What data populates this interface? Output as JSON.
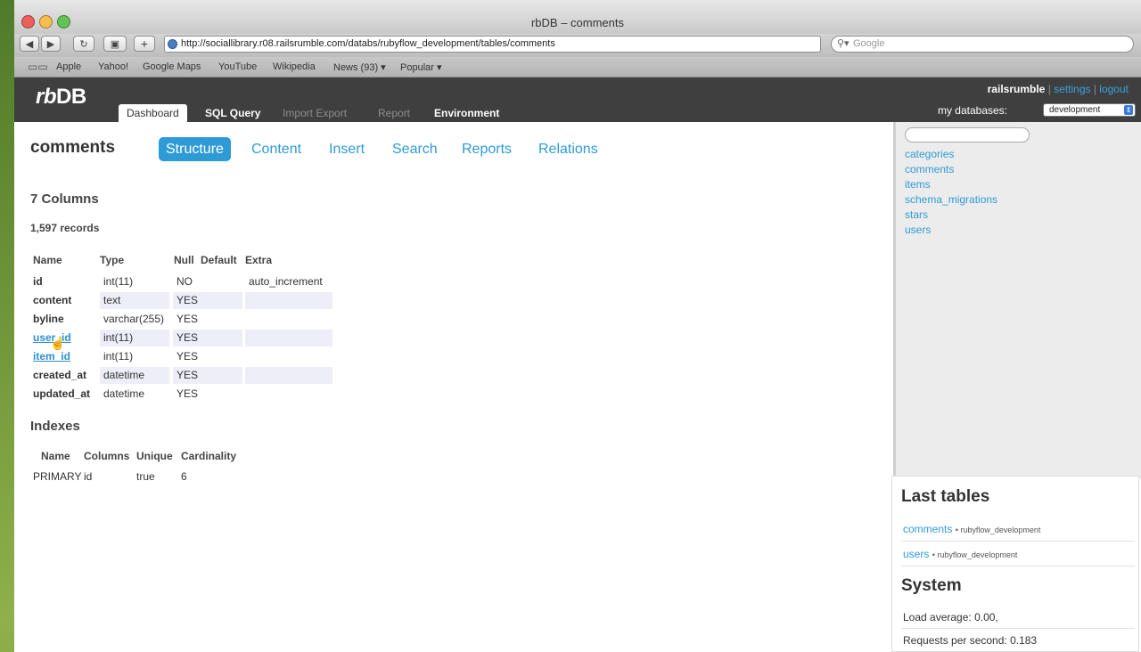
{
  "browser": {
    "title": "rbDB – comments",
    "url": "http://sociallibrary.r08.railsrumble.com/databs/rubyflow_development/tables/comments",
    "search_placeholder": "Google",
    "bookmarks": [
      "Apple",
      "Yahoo!",
      "Google Maps",
      "YouTube",
      "Wikipedia",
      "News (93) ▾",
      "Popular ▾"
    ]
  },
  "app": {
    "logo_prefix": "rb",
    "logo_suffix": "DB",
    "tabs": [
      "Dashboard",
      "SQL Query",
      "Import Export",
      "Report",
      "Environment"
    ],
    "user": "railsrumble",
    "settings": "settings",
    "logout": "logout",
    "my_databases_label": "my databases:",
    "selected_database": "development"
  },
  "table": {
    "name": "comments",
    "subtabs": [
      "Structure",
      "Content",
      "Insert",
      "Search",
      "Reports",
      "Relations"
    ],
    "columns_heading": "7 Columns",
    "records": "1,597 records",
    "column_headers": [
      "Name",
      "Type",
      "Null",
      "Default",
      "Extra"
    ],
    "columns": [
      {
        "name": "id",
        "type": "int(11)",
        "null": "NO",
        "default": "",
        "extra": "auto_increment"
      },
      {
        "name": "content",
        "type": "text",
        "null": "YES",
        "default": "",
        "extra": ""
      },
      {
        "name": "byline",
        "type": "varchar(255)",
        "null": "YES",
        "default": "",
        "extra": ""
      },
      {
        "name": "user_id",
        "type": "int(11)",
        "null": "YES",
        "default": "",
        "extra": ""
      },
      {
        "name": "item_id",
        "type": "int(11)",
        "null": "YES",
        "default": "",
        "extra": ""
      },
      {
        "name": "created_at",
        "type": "datetime",
        "null": "YES",
        "default": "",
        "extra": ""
      },
      {
        "name": "updated_at",
        "type": "datetime",
        "null": "YES",
        "default": "",
        "extra": ""
      }
    ],
    "indexes_heading": "Indexes",
    "index_headers": [
      "Name",
      "Columns",
      "Unique",
      "Cardinality"
    ],
    "indexes": [
      {
        "name": "PRIMARY",
        "columns": "id",
        "unique": "true",
        "cardinality": "6"
      }
    ]
  },
  "sidebar": {
    "tables": [
      "categories",
      "comments",
      "items",
      "schema_migrations",
      "stars",
      "users"
    ]
  },
  "last_tables": {
    "heading": "Last tables",
    "items": [
      {
        "table": "comments",
        "schema": "• rubyflow_development"
      },
      {
        "table": "users",
        "schema": "• rubyflow_development"
      }
    ]
  },
  "system": {
    "heading": "System",
    "load_average": "Load average: 0.00,",
    "requests": "Requests per second: 0.183"
  }
}
